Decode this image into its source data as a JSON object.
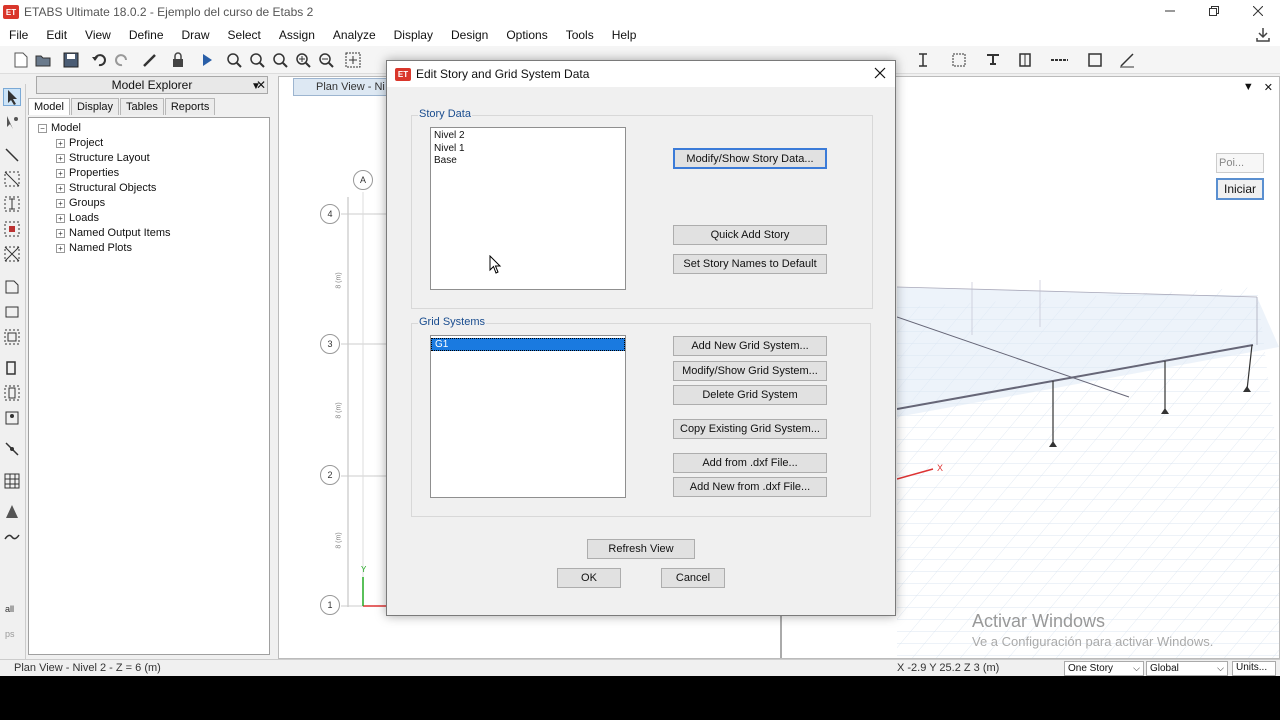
{
  "app": {
    "title": "ETABS Ultimate 18.0.2 - Ejemplo del curso de Etabs 2",
    "logo_text": "ET",
    "window_controls": [
      "minimize",
      "restore",
      "close"
    ]
  },
  "menu": [
    "File",
    "Edit",
    "View",
    "Define",
    "Draw",
    "Select",
    "Assign",
    "Analyze",
    "Display",
    "Design",
    "Options",
    "Tools",
    "Help"
  ],
  "explorer": {
    "title": "Model Explorer",
    "tabs": [
      "Model",
      "Display",
      "Tables",
      "Reports"
    ],
    "root": "Model",
    "items": [
      "Project",
      "Structure Layout",
      "Properties",
      "Structural Objects",
      "Groups",
      "Loads",
      "Named Output Items",
      "Named Plots"
    ]
  },
  "planview": {
    "tab_label": "Plan View - Ni",
    "grid_bubbles_row": [
      "4",
      "3",
      "2",
      "1"
    ],
    "grid_bubble_col": "A",
    "dim_label": "8 (m)"
  },
  "side_panel": {
    "poi_text": "Poi...",
    "iniciar": "Iniciar"
  },
  "watermark": {
    "line1": "Activar Windows",
    "line2": "Ve a Configuración para activar Windows."
  },
  "status": {
    "left": "Plan View - Nivel 2 - Z = 6 (m)",
    "coords": "X -2.9  Y 25.2  Z 3 (m)",
    "story_mode": "One Story",
    "coord_system": "Global",
    "units": "Units..."
  },
  "dialog": {
    "title": "Edit Story and Grid System Data",
    "story_data": {
      "label": "Story Data",
      "stories": [
        "Nivel 2",
        "Nivel 1",
        "Base"
      ],
      "buttons": {
        "modify_show": "Modify/Show Story Data...",
        "quick_add": "Quick Add Story",
        "set_default": "Set Story Names to Default"
      }
    },
    "grid_systems": {
      "label": "Grid Systems",
      "systems": [
        "G1"
      ],
      "buttons": {
        "add_new": "Add New Grid System...",
        "modify_show": "Modify/Show Grid System...",
        "delete": "Delete Grid System",
        "copy_existing": "Copy Existing Grid System...",
        "add_from_dxf": "Add  from .dxf File...",
        "add_new_from_dxf": "Add New from .dxf File..."
      }
    },
    "refresh": "Refresh View",
    "ok": "OK",
    "cancel": "Cancel"
  }
}
